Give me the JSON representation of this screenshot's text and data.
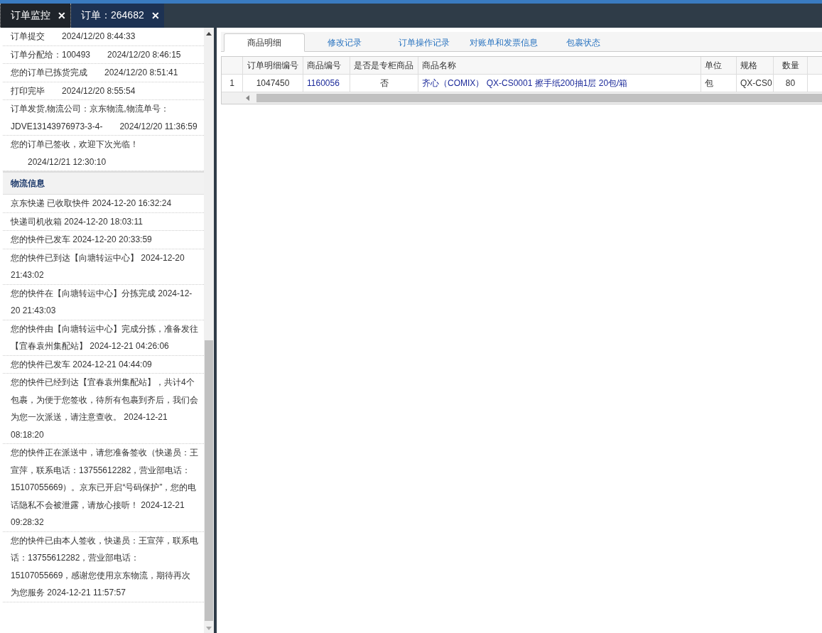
{
  "tabs": [
    {
      "label": "订单监控",
      "close": "✕",
      "selected": false
    },
    {
      "label": "订单：264682",
      "close": "✕",
      "selected": true
    }
  ],
  "order_log": [
    {
      "label": "订单提交",
      "time": "2024/12/20 8:44:33"
    },
    {
      "label": "订单分配给：100493",
      "time": "2024/12/20 8:46:15"
    },
    {
      "label": "您的订单已拣货完成",
      "time": "2024/12/20 8:51:41"
    },
    {
      "label": "打印完毕",
      "time": "2024/12/20 8:55:54"
    },
    {
      "label": "订单发货,物流公司：京东物流,物流单号：JDVE13143976973-3-4-",
      "time": "2024/12/20 11:36:59"
    },
    {
      "label": "您的订单已签收，欢迎下次光临！",
      "time": "2024/12/21 12:30:10"
    }
  ],
  "logistics": {
    "title": "物流信息",
    "entries": [
      "京东快递 已收取快件 2024-12-20 16:32:24",
      "快递司机收箱 2024-12-20 18:03:11",
      "您的快件已发车 2024-12-20 20:33:59",
      "您的快件已到达【向塘转运中心】 2024-12-20 21:43:02",
      "您的快件在【向塘转运中心】分拣完成 2024-12-20 21:43:03",
      "您的快件由【向塘转运中心】完成分拣，准备发往【宜春袁州集配站】 2024-12-21 04:26:06",
      "您的快件已发车 2024-12-21 04:44:09",
      "您的快件已经到达【宜春袁州集配站】，共计4个包裹，为便于您签收，待所有包裹到齐后，我们会为您一次派送，请注意查收。 2024-12-21 08:18:20",
      "您的快件正在派送中，请您准备签收（快递员：王宣萍，联系电话：13755612282，营业部电话：15107055669）。京东已开启“号码保护”，您的电话隐私不会被泄露，请放心接听！ 2024-12-21 09:28:32",
      "您的快件已由本人签收，快递员：王宣萍，联系电话：13755612282，营业部电话：15107055669，感谢您使用京东物流，期待再次为您服务 2024-12-21 11:57:57"
    ]
  },
  "detail_tabs": [
    {
      "label": "商品明细",
      "selected": true
    },
    {
      "label": "修改记录",
      "selected": false
    },
    {
      "label": "订单操作记录",
      "selected": false
    },
    {
      "label": "对账单和发票信息",
      "selected": false
    },
    {
      "label": "包裹状态",
      "selected": false
    }
  ],
  "table": {
    "columns": [
      "订单明细编号",
      "商品编号",
      "是否是专柜商品",
      "商品名称",
      "单位",
      "规格",
      "数量"
    ],
    "rows": [
      {
        "index": "1",
        "cells": [
          {
            "text": "1047450",
            "kind": "plain"
          },
          {
            "text": "1160056",
            "kind": "link"
          },
          {
            "text": "否",
            "kind": "plain"
          },
          {
            "text": "齐心（COMIX） QX-CS0001 擦手纸200抽1层 20包/箱",
            "kind": "link"
          },
          {
            "text": "包",
            "kind": "plain"
          },
          {
            "text": "QX-CS0",
            "kind": "plain"
          },
          {
            "text": "80",
            "kind": "plain"
          }
        ]
      }
    ]
  }
}
